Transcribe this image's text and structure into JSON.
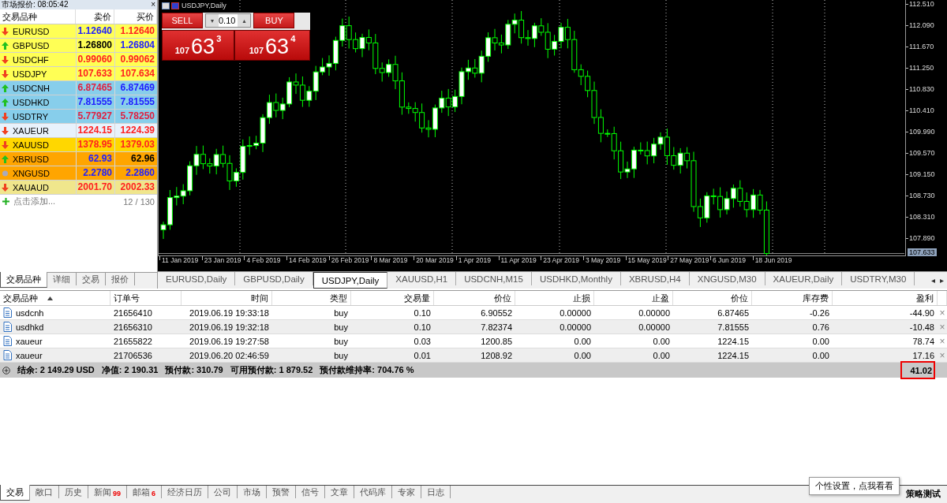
{
  "market_watch": {
    "title": "市场报价: 08:05:42",
    "close": "×",
    "columns": [
      "交易品种",
      "卖价",
      "买价"
    ],
    "rows": [
      {
        "symbol": "EURUSD",
        "kind": "down",
        "color": "#ffff55",
        "bid": {
          "value": "1.12640",
          "color": "#2020ff"
        },
        "ask": {
          "value": "1.12640",
          "color": "#ff2020"
        }
      },
      {
        "symbol": "GBPUSD",
        "kind": "up",
        "color": "#ffff55",
        "bid": {
          "value": "1.26800",
          "color": "#000000"
        },
        "ask": {
          "value": "1.26804",
          "color": "#2020ff"
        }
      },
      {
        "symbol": "USDCHF",
        "kind": "down",
        "color": "#ffff55",
        "bid": {
          "value": "0.99060",
          "color": "#ff2020"
        },
        "ask": {
          "value": "0.99062",
          "color": "#ff2020"
        }
      },
      {
        "symbol": "USDJPY",
        "kind": "down",
        "color": "#ffff55",
        "bid": {
          "value": "107.633",
          "color": "#ff2020"
        },
        "ask": {
          "value": "107.634",
          "color": "#ff2020"
        }
      },
      {
        "symbol": "USDCNH",
        "kind": "up",
        "color": "#87ceeb",
        "bid": {
          "value": "6.87465",
          "color": "#e02040"
        },
        "ask": {
          "value": "6.87469",
          "color": "#2020ff"
        }
      },
      {
        "symbol": "USDHKD",
        "kind": "up",
        "color": "#87ceeb",
        "bid": {
          "value": "7.81555",
          "color": "#2020ff"
        },
        "ask": {
          "value": "7.81555",
          "color": "#2020ff"
        }
      },
      {
        "symbol": "USDTRY",
        "kind": "down",
        "color": "#87ceeb",
        "bid": {
          "value": "5.77927",
          "color": "#e02040"
        },
        "ask": {
          "value": "5.78250",
          "color": "#e02040"
        }
      },
      {
        "symbol": "XAUEUR",
        "kind": "down",
        "color": "#e8f2fc",
        "bid": {
          "value": "1224.15",
          "color": "#ff2020"
        },
        "ask": {
          "value": "1224.39",
          "color": "#ff2020"
        }
      },
      {
        "symbol": "XAUUSD",
        "kind": "down",
        "color": "#ffd700",
        "bid": {
          "value": "1378.95",
          "color": "#ff2020"
        },
        "ask": {
          "value": "1379.03",
          "color": "#ff2020"
        }
      },
      {
        "symbol": "XBRUSD",
        "kind": "up",
        "color": "#ffa500",
        "bid": {
          "value": "62.93",
          "color": "#2020ff"
        },
        "ask": {
          "value": "62.96",
          "color": "#000000"
        }
      },
      {
        "symbol": "XNGUSD",
        "kind": "none",
        "color": "#ffa500",
        "bid": {
          "value": "2.2780",
          "color": "#2020ff"
        },
        "ask": {
          "value": "2.2860",
          "color": "#2020ff"
        }
      },
      {
        "symbol": "XAUAUD",
        "kind": "down",
        "color": "#f0e68c",
        "bid": {
          "value": "2001.70",
          "color": "#ff2020"
        },
        "ask": {
          "value": "2002.33",
          "color": "#ff2020"
        }
      }
    ],
    "add_label": "点击添加...",
    "count": "12 / 130",
    "tabs": [
      {
        "label": "交易品种",
        "selected": true
      },
      {
        "label": "详细",
        "selected": false
      },
      {
        "label": "交易",
        "selected": false
      },
      {
        "label": "报价",
        "selected": false
      }
    ]
  },
  "chart": {
    "title": "USDJPY,Daily",
    "trade_panel": {
      "sell": "SELL",
      "buy": "BUY",
      "lot": "0.10",
      "down": "▾",
      "up": "▴",
      "sell_price": {
        "big": "107",
        "main": "63",
        "small": "3"
      },
      "buy_price": {
        "big": "107",
        "main": "63",
        "small": "4"
      }
    },
    "price_axis": [
      "112.510",
      "112.090",
      "111.670",
      "111.250",
      "110.830",
      "110.410",
      "109.990",
      "109.570",
      "109.150",
      "108.730",
      "108.310",
      "107.890"
    ],
    "current_price": "107.633",
    "date_axis": [
      "11 Jan 2019",
      "23 Jan 2019",
      "4 Feb 2019",
      "14 Feb 2019",
      "26 Feb 2019",
      "8 Mar 2019",
      "20 Mar 2019",
      "1 Apr 2019",
      "11 Apr 2019",
      "23 Apr 2019",
      "3 May 2019",
      "15 May 2019",
      "27 May 2019",
      "6 Jun 2019",
      "18 Jun 2019"
    ],
    "tabs": [
      {
        "label": "EURUSD,Daily",
        "selected": false
      },
      {
        "label": "GBPUSD,Daily",
        "selected": false
      },
      {
        "label": "USDJPY,Daily",
        "selected": true
      },
      {
        "label": "XAUUSD,H1",
        "selected": false
      },
      {
        "label": "USDCNH,M15",
        "selected": false
      },
      {
        "label": "USDHKD,Monthly",
        "selected": false
      },
      {
        "label": "XBRUSD,H4",
        "selected": false
      },
      {
        "label": "XNGUSD,M30",
        "selected": false
      },
      {
        "label": "XAUEUR,Daily",
        "selected": false
      },
      {
        "label": "USDTRY,M30",
        "selected": false
      }
    ],
    "scroll_left": "◂",
    "scroll_right": "▸"
  },
  "trades": {
    "columns": [
      "交易品种",
      "订单号",
      "时间",
      "类型",
      "交易量",
      "价位",
      "止损",
      "止盈",
      "价位",
      "库存费",
      "盈利"
    ],
    "rows": [
      {
        "cells": [
          "usdcnh",
          "21656410",
          "2019.06.19 19:33:18",
          "buy",
          "0.10",
          "6.90552",
          "0.00000",
          "0.00000",
          "6.87465",
          "-0.26",
          "-44.90"
        ],
        "close": "×"
      },
      {
        "cells": [
          "usdhkd",
          "21656310",
          "2019.06.19 19:32:18",
          "buy",
          "0.10",
          "7.82374",
          "0.00000",
          "0.00000",
          "7.81555",
          "0.76",
          "-10.48"
        ],
        "close": "×"
      },
      {
        "cells": [
          "xaueur",
          "21655822",
          "2019.06.19 19:27:58",
          "buy",
          "0.03",
          "1200.85",
          "0.00",
          "0.00",
          "1224.15",
          "0.00",
          "78.74"
        ],
        "close": "×"
      },
      {
        "cells": [
          "xaueur",
          "21706536",
          "2019.06.20 02:46:59",
          "buy",
          "0.01",
          "1208.92",
          "0.00",
          "0.00",
          "1224.15",
          "0.00",
          "17.16"
        ],
        "close": "×"
      }
    ],
    "summary": [
      "结余: 2 149.29 USD",
      "净值: 2 190.31",
      "预付款: 310.79",
      "可用预付款: 1 879.52",
      "预付款维持率: 704.76 %"
    ],
    "total": "41.02"
  },
  "toolbox": {
    "tabs": [
      {
        "label": "交易",
        "selected": true
      },
      {
        "label": "敞口",
        "selected": false
      },
      {
        "label": "历史",
        "selected": false
      },
      {
        "label": "新闻",
        "badge": "99",
        "selected": false
      },
      {
        "label": "邮箱",
        "badge": "6",
        "selected": false
      },
      {
        "label": "经济日历",
        "selected": false
      },
      {
        "label": "公司",
        "selected": false
      },
      {
        "label": "市场",
        "selected": false
      },
      {
        "label": "预警",
        "selected": false
      },
      {
        "label": "信号",
        "selected": false
      },
      {
        "label": "文章",
        "selected": false
      },
      {
        "label": "代码库",
        "selected": false
      },
      {
        "label": "专家",
        "selected": false
      },
      {
        "label": "日志",
        "selected": false
      }
    ],
    "tooltip": "个性设置，点我看看",
    "right_tab": "策略测试"
  }
}
